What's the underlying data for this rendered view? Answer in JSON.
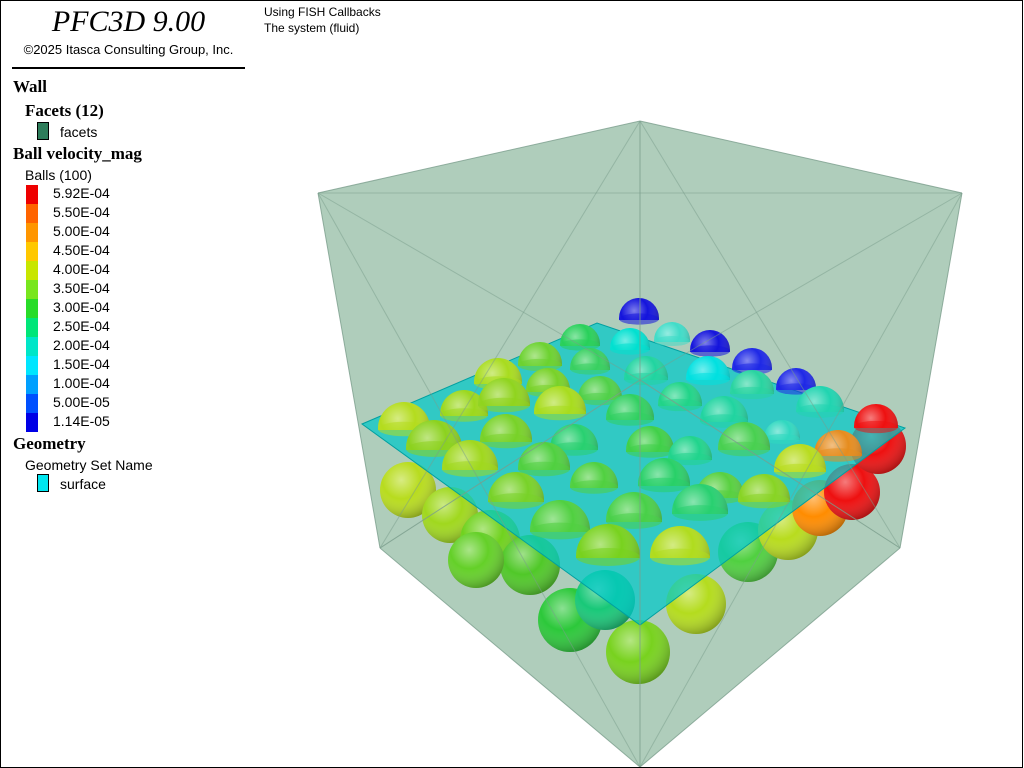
{
  "app": {
    "title": "PFC3D 9.00",
    "copyright": "©2025 Itasca Consulting Group, Inc."
  },
  "view": {
    "line1": "Using FISH Callbacks",
    "line2": "The system (fluid)"
  },
  "legend": {
    "wall": {
      "heading": "Wall",
      "facets_heading": "Facets (12)",
      "facets_label": "facets",
      "facets_color": "#2e7d5b"
    },
    "ball": {
      "heading": "Ball velocity_mag",
      "subheading": "Balls (100)",
      "scale": [
        {
          "label": "5.92E-04",
          "color": "#ee0000"
        },
        {
          "label": "5.50E-04",
          "color": "#ff6400"
        },
        {
          "label": "5.00E-04",
          "color": "#ff9600"
        },
        {
          "label": "4.50E-04",
          "color": "#ffc800"
        },
        {
          "label": "4.00E-04",
          "color": "#c8e600"
        },
        {
          "label": "3.50E-04",
          "color": "#78e61e"
        },
        {
          "label": "3.00E-04",
          "color": "#28dc28"
        },
        {
          "label": "2.50E-04",
          "color": "#00e678"
        },
        {
          "label": "2.00E-04",
          "color": "#00e6c8"
        },
        {
          "label": "1.50E-04",
          "color": "#00e6ff"
        },
        {
          "label": "1.00E-04",
          "color": "#00a0ff"
        },
        {
          "label": "5.00E-05",
          "color": "#0050ff"
        },
        {
          "label": "1.14E-05",
          "color": "#0000e6"
        }
      ]
    },
    "geometry": {
      "heading": "Geometry",
      "set_name": "Geometry Set Name",
      "surface_label": "surface",
      "surface_color": "#00e6f0"
    }
  }
}
